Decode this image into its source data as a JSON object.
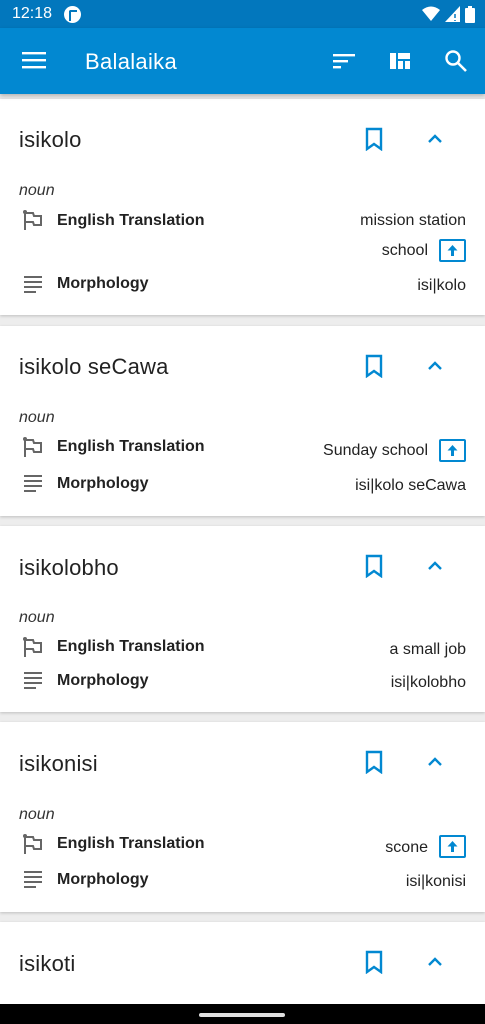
{
  "status": {
    "time": "12:18"
  },
  "appbar": {
    "title": "Balalaika"
  },
  "labels": {
    "translation": "English Translation",
    "morphology": "Morphology"
  },
  "entries": [
    {
      "word": "isikolo",
      "pos": "noun",
      "translations": [
        "mission station",
        "school"
      ],
      "morphology": "isi|kolo"
    },
    {
      "word": "isikolo seCawa",
      "pos": "noun",
      "translations": [
        "Sunday school"
      ],
      "morphology": "isi|kolo seCawa"
    },
    {
      "word": "isikolobho",
      "pos": "noun",
      "translations": [
        "a small job"
      ],
      "morphology": "isi|kolobho"
    },
    {
      "word": "isikonisi",
      "pos": "noun",
      "translations": [
        "scone"
      ],
      "morphology": "isi|konisi"
    },
    {
      "word": "isikoti"
    }
  ],
  "colors": {
    "primary": "#0288d1",
    "status_bar": "#0277bd"
  }
}
